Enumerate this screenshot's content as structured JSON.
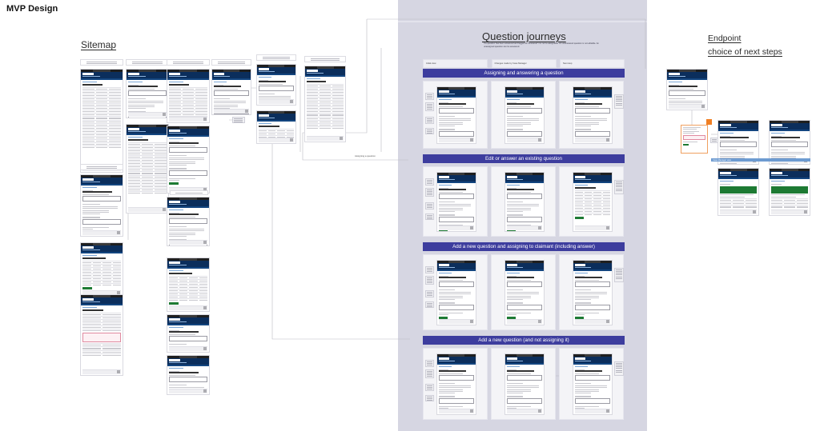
{
  "document": {
    "title": "MVP Design"
  },
  "sections": {
    "sitemap": {
      "heading": "Sitemap"
    },
    "journeys": {
      "heading": "Question journeys",
      "note": "If a question has been answered and tagged as 'answered' it is not re-assignable. An unanswered question is not editable. An unassigned question can be answered.",
      "columns": [
        {
          "label": "Initial view"
        },
        {
          "label": "Changes made by Case Manager"
        },
        {
          "label": "Next step"
        }
      ],
      "rows": [
        {
          "label": "Assigning and answering a question"
        },
        {
          "label": "Edit or answer an existing question"
        },
        {
          "label": "Add a new question and assigning to claimant (including answer)"
        },
        {
          "label": "Add a new question (and not assigning it)"
        }
      ]
    },
    "endpoint": {
      "heading_line1": "Endpoint",
      "heading_line2": "choice of next steps",
      "divider_label": "Case Manager view"
    }
  },
  "connectors": [
    {
      "label": "Assigning a question"
    }
  ],
  "colors": {
    "panel_background": "#d6d6e2",
    "section_bar": "#3d3d9e",
    "govuk_header": "#0b2e5c",
    "confirmation_green": "#1d7a33",
    "divider_blue": "#6d9bd1",
    "accent_orange": "#f07f23",
    "page_background": "#ffffff"
  }
}
